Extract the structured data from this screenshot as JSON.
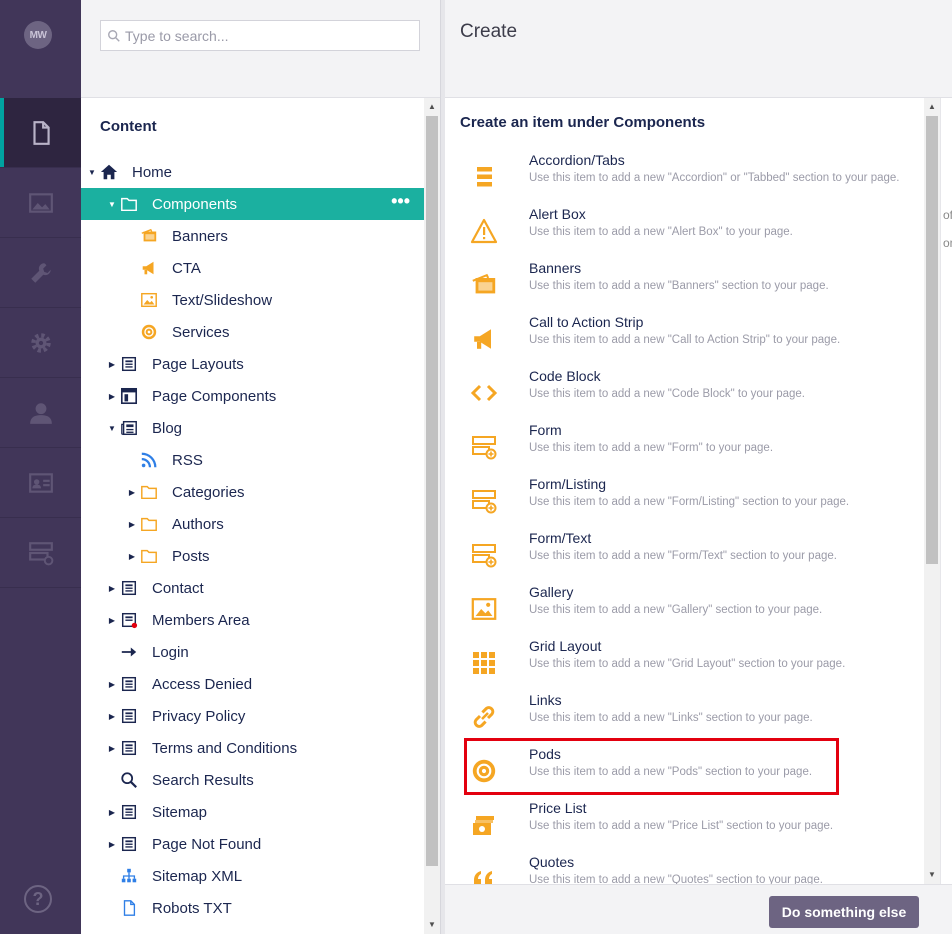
{
  "rail": {
    "avatar_initials": "MW",
    "sections": [
      {
        "name": "content",
        "icon": "document-icon",
        "active": true
      },
      {
        "name": "media",
        "icon": "image-icon",
        "active": false
      },
      {
        "name": "settings",
        "icon": "wrench-icon",
        "active": false
      },
      {
        "name": "packages",
        "icon": "gear-icon",
        "active": false
      },
      {
        "name": "users",
        "icon": "user-icon",
        "active": false
      },
      {
        "name": "members",
        "icon": "id-card-icon",
        "active": false
      },
      {
        "name": "forms",
        "icon": "form-icon",
        "active": false
      }
    ],
    "help_label": "?"
  },
  "tree_panel": {
    "search_placeholder": "Type to search...",
    "title": "Content",
    "nodes": [
      {
        "label": "Home",
        "icon": "home-icon",
        "depth": 0,
        "caret": "expanded"
      },
      {
        "label": "Components",
        "icon": "folder-icon",
        "depth": 1,
        "caret": "expanded",
        "selected": true,
        "actions": "•••"
      },
      {
        "label": "Banners",
        "icon": "banners-icon",
        "depth": 2,
        "caret": "none"
      },
      {
        "label": "CTA",
        "icon": "megaphone-icon",
        "depth": 2,
        "caret": "none"
      },
      {
        "label": "Text/Slideshow",
        "icon": "image-icon",
        "depth": 2,
        "caret": "none"
      },
      {
        "label": "Services",
        "icon": "target-icon",
        "depth": 2,
        "caret": "none"
      },
      {
        "label": "Page Layouts",
        "icon": "page-icon",
        "depth": 1,
        "caret": "collapsed"
      },
      {
        "label": "Page Components",
        "icon": "layout-icon",
        "depth": 1,
        "caret": "collapsed"
      },
      {
        "label": "Blog",
        "icon": "newspaper-icon",
        "depth": 1,
        "caret": "expanded"
      },
      {
        "label": "RSS",
        "icon": "rss-icon",
        "depth": 2,
        "caret": "none"
      },
      {
        "label": "Categories",
        "icon": "folder-orange-icon",
        "depth": 2,
        "caret": "collapsed"
      },
      {
        "label": "Authors",
        "icon": "folder-orange-icon",
        "depth": 2,
        "caret": "collapsed"
      },
      {
        "label": "Posts",
        "icon": "folder-orange-icon",
        "depth": 2,
        "caret": "collapsed"
      },
      {
        "label": "Contact",
        "icon": "page-icon",
        "depth": 1,
        "caret": "collapsed"
      },
      {
        "label": "Members Area",
        "icon": "page-protected-icon",
        "depth": 1,
        "caret": "collapsed"
      },
      {
        "label": "Login",
        "icon": "arrow-right-icon",
        "depth": 1,
        "caret": "none"
      },
      {
        "label": "Access Denied",
        "icon": "page-icon",
        "depth": 1,
        "caret": "collapsed"
      },
      {
        "label": "Privacy Policy",
        "icon": "page-icon",
        "depth": 1,
        "caret": "collapsed"
      },
      {
        "label": "Terms and Conditions",
        "icon": "page-icon",
        "depth": 1,
        "caret": "collapsed"
      },
      {
        "label": "Search Results",
        "icon": "search-icon",
        "depth": 1,
        "caret": "none"
      },
      {
        "label": "Sitemap",
        "icon": "page-icon",
        "depth": 1,
        "caret": "collapsed"
      },
      {
        "label": "Page Not Found",
        "icon": "page-icon",
        "depth": 1,
        "caret": "collapsed"
      },
      {
        "label": "Sitemap XML",
        "icon": "sitemap-icon",
        "depth": 1,
        "caret": "none"
      },
      {
        "label": "Robots TXT",
        "icon": "file-icon",
        "depth": 1,
        "caret": "none"
      }
    ]
  },
  "create_panel": {
    "title": "Create",
    "subtitle": "Create an item under Components",
    "items": [
      {
        "name": "Accordion/Tabs",
        "desc": "Use this item to add a new \"Accordion\" or \"Tabbed\" section to your page.",
        "icon": "accordion-icon"
      },
      {
        "name": "Alert Box",
        "desc": "Use this item to add a new \"Alert Box\" to your page.",
        "icon": "alert-icon"
      },
      {
        "name": "Banners",
        "desc": "Use this item to add a new \"Banners\" section to your page.",
        "icon": "banners-icon"
      },
      {
        "name": "Call to Action Strip",
        "desc": "Use this item to add a new \"Call to Action Strip\" to your page.",
        "icon": "megaphone-icon"
      },
      {
        "name": "Code Block",
        "desc": "Use this item to add a new \"Code Block\" to your page.",
        "icon": "code-icon"
      },
      {
        "name": "Form",
        "desc": "Use this item to add a new \"Form\" to your page.",
        "icon": "form-icon"
      },
      {
        "name": "Form/Listing",
        "desc": "Use this item to add a new \"Form/Listing\" section to your page.",
        "icon": "form-icon"
      },
      {
        "name": "Form/Text",
        "desc": "Use this item to add a new \"Form/Text\" section to your page.",
        "icon": "form-icon"
      },
      {
        "name": "Gallery",
        "desc": "Use this item to add a new \"Gallery\" section to your page.",
        "icon": "image-icon"
      },
      {
        "name": "Grid Layout",
        "desc": "Use this item to add a new \"Grid Layout\" section to your page.",
        "icon": "grid-icon"
      },
      {
        "name": "Links",
        "desc": "Use this item to add a new \"Links\" section to your page.",
        "icon": "link-icon"
      },
      {
        "name": "Pods",
        "desc": "Use this item to add a new \"Pods\" section to your page.",
        "icon": "target-icon",
        "highlighted": true
      },
      {
        "name": "Price List",
        "desc": "Use this item to add a new \"Price List\" section to your page.",
        "icon": "price-icon"
      },
      {
        "name": "Quotes",
        "desc": "Use this item to add a new \"Quotes\" section to your page.",
        "icon": "quote-icon"
      }
    ],
    "footer_button": "Do something else",
    "edge_fragments": [
      "of",
      "on"
    ]
  },
  "colors": {
    "rail_bg": "#413659",
    "accent_teal": "#1bb0a0",
    "icon_orange": "#f5a623",
    "highlight_red": "#e3000f",
    "button_purple": "#6d6482"
  }
}
